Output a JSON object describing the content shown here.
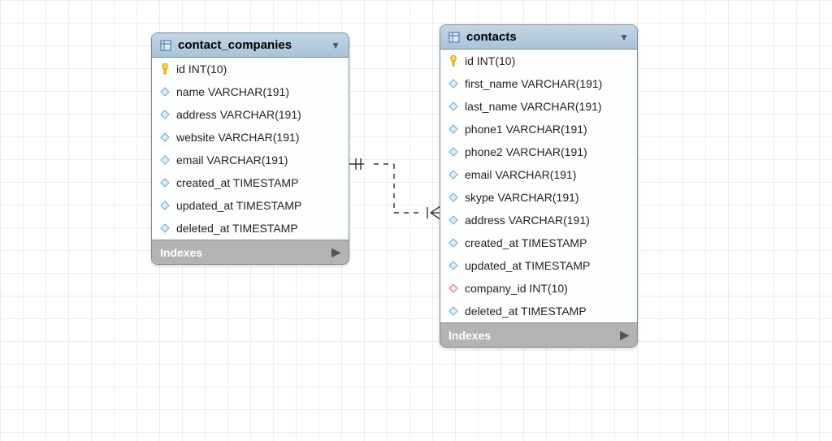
{
  "tables": {
    "contact_companies": {
      "title": "contact_companies",
      "indexes_label": "Indexes",
      "columns": [
        {
          "icon": "pk",
          "text": "id INT(10)"
        },
        {
          "icon": "attr",
          "text": "name VARCHAR(191)"
        },
        {
          "icon": "attr",
          "text": "address VARCHAR(191)"
        },
        {
          "icon": "attr",
          "text": "website VARCHAR(191)"
        },
        {
          "icon": "attr",
          "text": "email VARCHAR(191)"
        },
        {
          "icon": "attr",
          "text": "created_at TIMESTAMP"
        },
        {
          "icon": "attr",
          "text": "updated_at TIMESTAMP"
        },
        {
          "icon": "attr",
          "text": "deleted_at TIMESTAMP"
        }
      ]
    },
    "contacts": {
      "title": "contacts",
      "indexes_label": "Indexes",
      "columns": [
        {
          "icon": "pk",
          "text": "id INT(10)"
        },
        {
          "icon": "attr",
          "text": "first_name VARCHAR(191)"
        },
        {
          "icon": "attr",
          "text": "last_name VARCHAR(191)"
        },
        {
          "icon": "attr",
          "text": "phone1 VARCHAR(191)"
        },
        {
          "icon": "attr",
          "text": "phone2 VARCHAR(191)"
        },
        {
          "icon": "attr",
          "text": "email VARCHAR(191)"
        },
        {
          "icon": "attr",
          "text": "skype VARCHAR(191)"
        },
        {
          "icon": "attr",
          "text": "address VARCHAR(191)"
        },
        {
          "icon": "attr",
          "text": "created_at TIMESTAMP"
        },
        {
          "icon": "attr",
          "text": "updated_at TIMESTAMP"
        },
        {
          "icon": "fk",
          "text": "company_id INT(10)"
        },
        {
          "icon": "attr",
          "text": "deleted_at TIMESTAMP"
        }
      ]
    }
  },
  "relationship": {
    "from_table": "contact_companies",
    "to_table": "contacts",
    "from_cardinality": "one",
    "to_cardinality": "many",
    "identifying": false
  },
  "colors": {
    "header_gradient_top": "#c2d6e6",
    "header_gradient_bottom": "#a9c3d8",
    "border": "#7a8a99",
    "grid": "#eceded",
    "footer_bg": "#b3b3b3"
  }
}
